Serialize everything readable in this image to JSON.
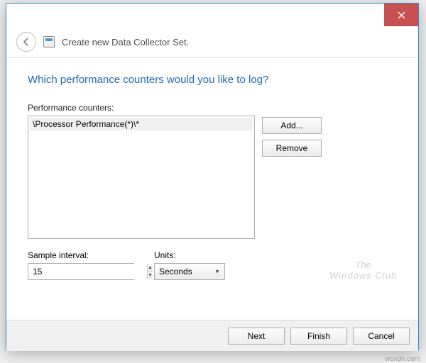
{
  "wizard": {
    "title": "Create new Data Collector Set."
  },
  "prompt": "Which performance counters would you like to log?",
  "counters": {
    "label": "Performance counters:",
    "items": [
      "\\Processor Performance(*)\\*"
    ]
  },
  "buttons": {
    "add": "Add...",
    "remove": "Remove",
    "next": "Next",
    "finish": "Finish",
    "cancel": "Cancel"
  },
  "interval": {
    "label": "Sample interval:",
    "value": "15"
  },
  "units": {
    "label": "Units:",
    "selected": "Seconds"
  },
  "watermark": {
    "line1": "The",
    "line2": "Windows Club"
  },
  "source": "wsxdn.com"
}
